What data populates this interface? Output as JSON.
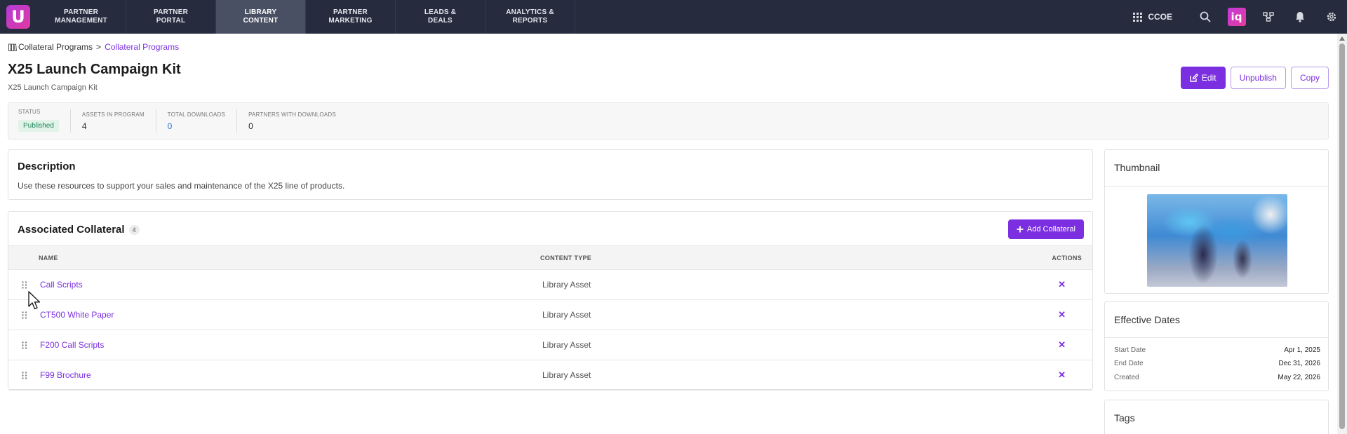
{
  "nav": {
    "logo": "U",
    "items": [
      {
        "label": "PARTNER\nMANAGEMENT",
        "active": false
      },
      {
        "label": "PARTNER\nPORTAL",
        "active": false
      },
      {
        "label": "LIBRARY\nCONTENT",
        "active": true
      },
      {
        "label": "PARTNER\nMARKETING",
        "active": false
      },
      {
        "label": "LEADS &\nDEALS",
        "active": false
      },
      {
        "label": "ANALYTICS &\nREPORTS",
        "active": false
      }
    ],
    "org_label": "CCOE",
    "iq_label": "iq",
    "icons": [
      "grid-icon",
      "search-icon",
      "iq-icon",
      "hierarchy-icon",
      "bell-icon",
      "gear-icon"
    ]
  },
  "breadcrumb": {
    "parent": "Collateral Programs",
    "separator": ">",
    "current": "Collateral Programs"
  },
  "page": {
    "title": "X25 Launch Campaign Kit",
    "subtitle": "X25 Launch Campaign Kit"
  },
  "actions": {
    "edit_label": "Edit",
    "unpublish_label": "Unpublish",
    "copy_label": "Copy"
  },
  "stats": {
    "status_label": "STATUS",
    "status_value": "Published",
    "assets_label": "ASSETS IN PROGRAM",
    "assets_value": "4",
    "downloads_label": "TOTAL DOWNLOADS",
    "downloads_value": "0",
    "partners_label": "PARTNERS WITH DOWNLOADS",
    "partners_value": "0"
  },
  "description": {
    "title": "Description",
    "text": "Use these resources to support your sales and maintenance of the X25 line of products."
  },
  "collateral": {
    "title": "Associated Collateral",
    "count": "4",
    "add_label": "Add Collateral",
    "columns": {
      "name": "NAME",
      "type": "CONTENT TYPE",
      "actions": "ACTIONS"
    },
    "rows": [
      {
        "name": "Call Scripts",
        "type": "Library Asset",
        "remove": "✕"
      },
      {
        "name": "CT500 White Paper",
        "type": "Library Asset",
        "remove": "✕"
      },
      {
        "name": "F200 Call Scripts",
        "type": "Library Asset",
        "remove": "✕"
      },
      {
        "name": "F99 Brochure",
        "type": "Library Asset",
        "remove": "✕"
      }
    ]
  },
  "sidebar": {
    "thumbnail_title": "Thumbnail",
    "dates_title": "Effective Dates",
    "dates": [
      {
        "label": "Start Date",
        "value": "Apr 1, 2025"
      },
      {
        "label": "End Date",
        "value": "Dec 31, 2026"
      },
      {
        "label": "Created",
        "value": "May 22, 2026"
      }
    ],
    "tags_title": "Tags"
  },
  "colors": {
    "accent": "#7b2fe0",
    "nav_bg": "#262b3d",
    "published_bg": "#e2f3e9",
    "published_text": "#22875a"
  }
}
